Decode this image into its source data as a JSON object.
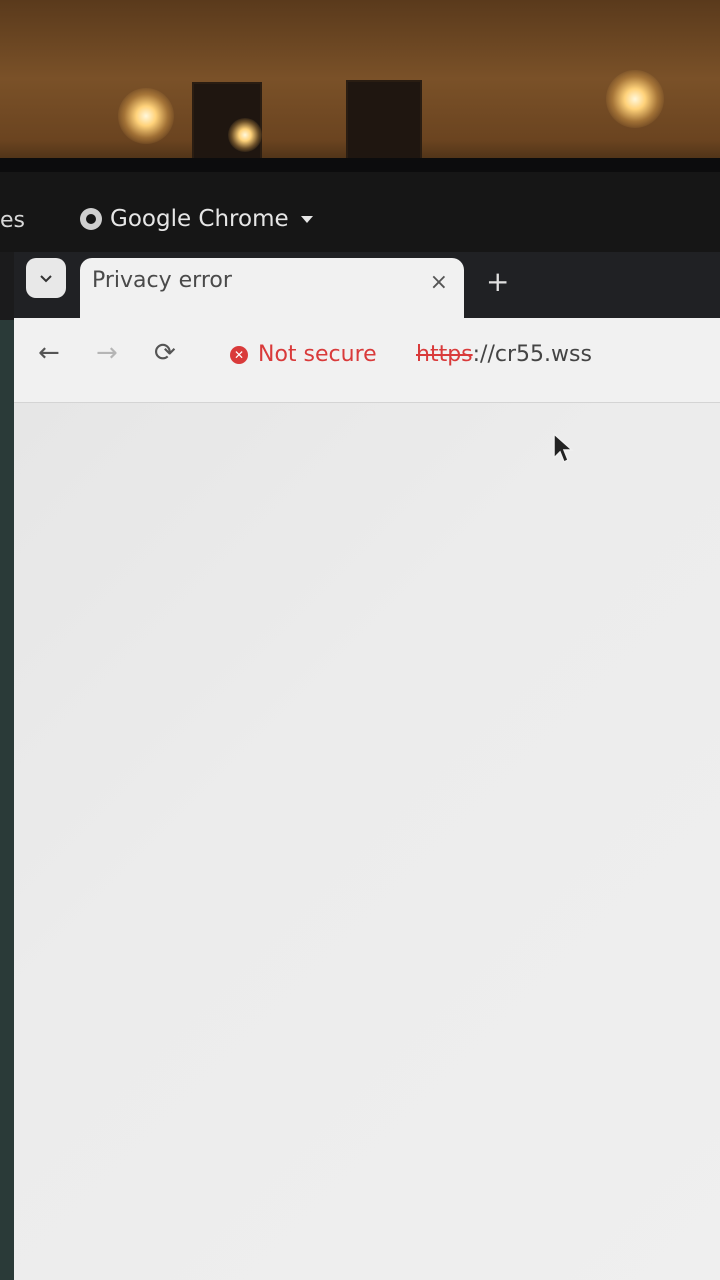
{
  "desktop": {
    "left_partial_label": "es",
    "app_menu_label": "Google Chrome"
  },
  "browser": {
    "tab": {
      "title": "Privacy error",
      "close_glyph": "×"
    },
    "new_tab_glyph": "+",
    "toolbar": {
      "back_glyph": "←",
      "forward_glyph": "→",
      "reload_glyph": "⟳",
      "security_label": "Not secure",
      "url_scheme": "https",
      "url_rest": "://cr55.wss"
    }
  },
  "colors": {
    "not_secure_red": "#d93a3a",
    "chrome_frame": "#202124",
    "toolbar_bg": "#f1f1f1"
  },
  "icons": [
    "chrome-icon",
    "chevron-down-icon",
    "close-icon",
    "plus-icon",
    "back-arrow-icon",
    "forward-arrow-icon",
    "reload-icon",
    "not-secure-icon",
    "mouse-cursor-icon"
  ]
}
